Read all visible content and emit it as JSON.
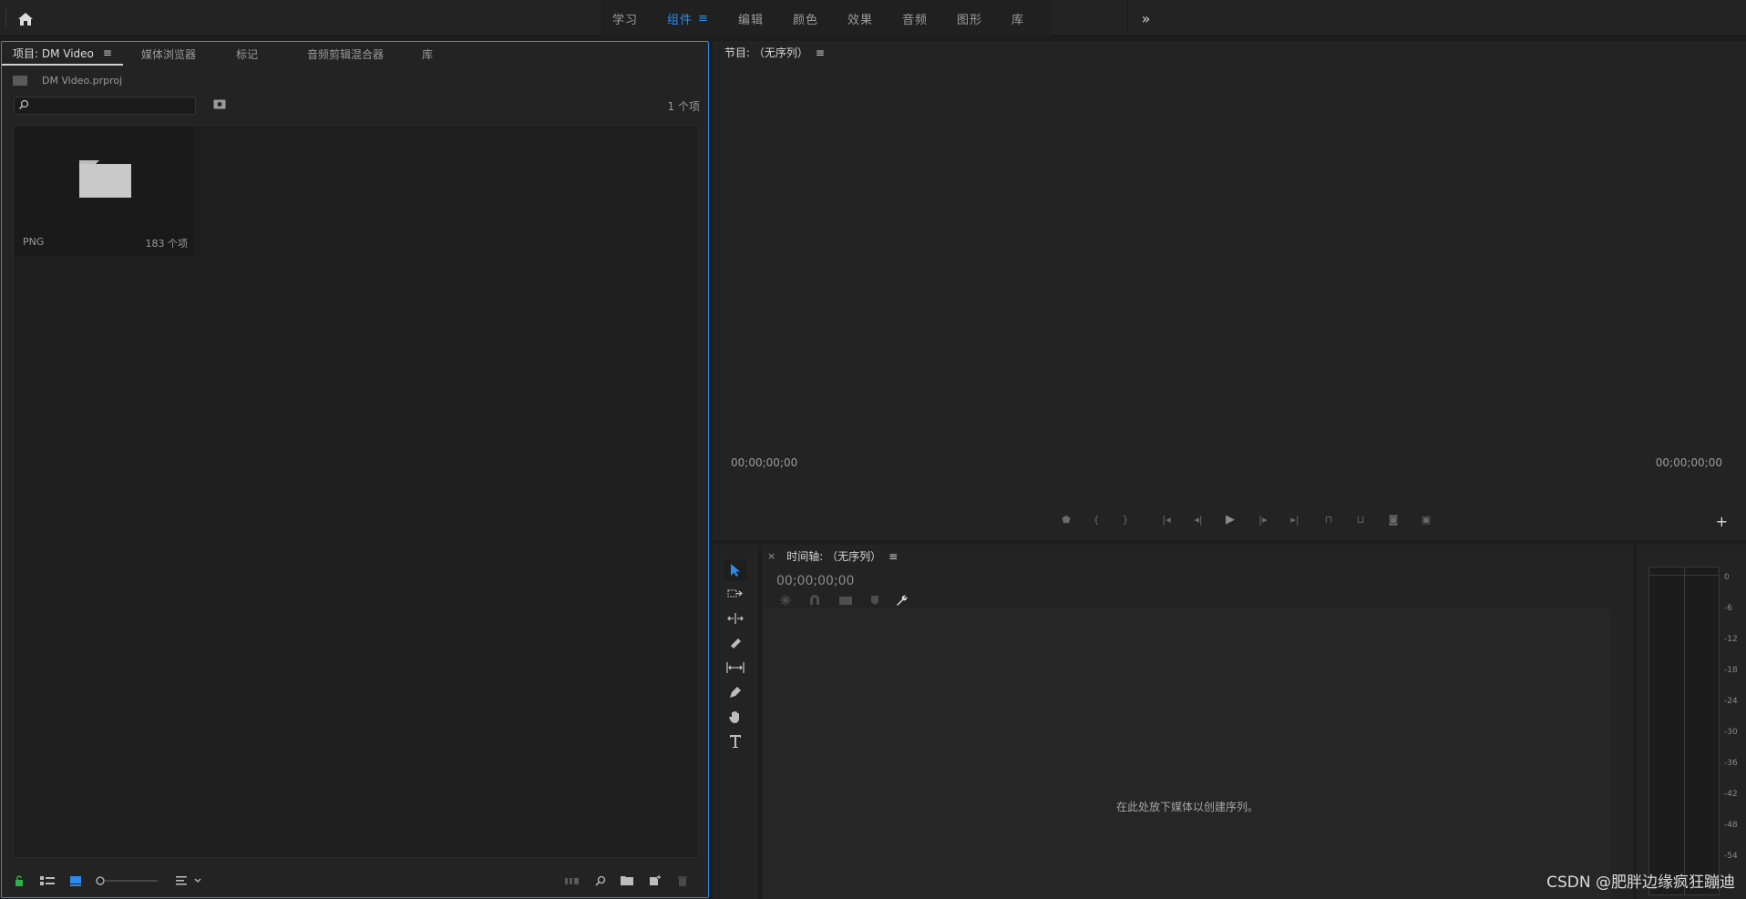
{
  "workspaces": {
    "tabs": [
      "学习",
      "组件",
      "编辑",
      "颜色",
      "效果",
      "音频",
      "图形",
      "库"
    ],
    "active_index": 1,
    "more_label": "»"
  },
  "project": {
    "tabs": [
      "项目: DM Video",
      "媒体浏览器",
      "标记",
      "音频剪辑混合器",
      "库"
    ],
    "file": "DM Video.prproj",
    "search_placeholder": "",
    "item_count": "1 个项",
    "bin": {
      "name": "PNG",
      "count": "183 个项"
    }
  },
  "program": {
    "title": "节目: （无序列）",
    "timecode_in": "00;00;00;00",
    "timecode_out": "00;00;00;00"
  },
  "timeline": {
    "title": "时间轴: （无序列）",
    "timecode": "00;00;00;00",
    "drop_message": "在此处放下媒体以创建序列。"
  },
  "meters": {
    "scale": [
      "0",
      "-6",
      "-12",
      "-18",
      "-24",
      "-30",
      "-36",
      "-42",
      "-48",
      "-54"
    ]
  },
  "watermark": "CSDN @肥胖边缘疯狂蹦迪",
  "colors": {
    "accent": "#2d8ceb",
    "panel": "#232323",
    "background": "#1d1d1d"
  }
}
